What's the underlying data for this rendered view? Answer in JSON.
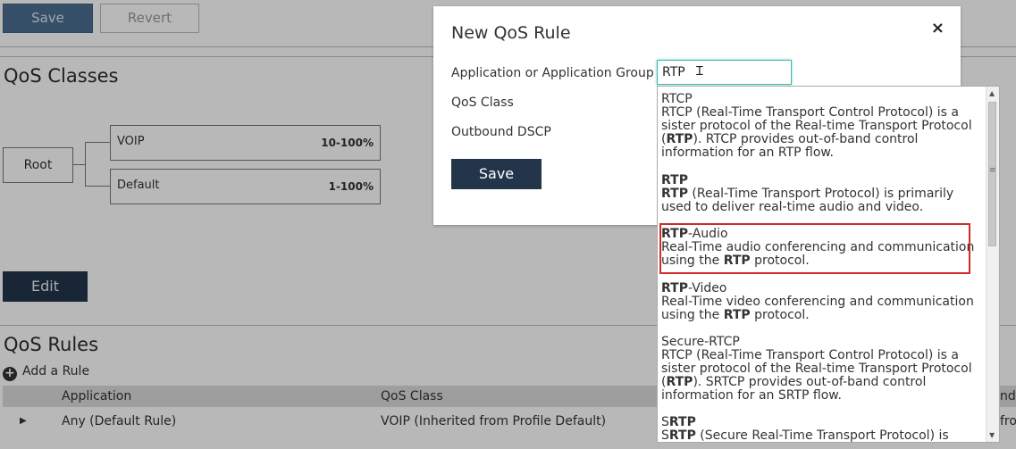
{
  "toolbar": {
    "save_label": "Save",
    "revert_label": "Revert"
  },
  "qos_classes": {
    "title": "QoS Classes",
    "root_label": "Root",
    "classes": [
      {
        "name": "VOIP",
        "range": "10-100%"
      },
      {
        "name": "Default",
        "range": "1-100%"
      }
    ],
    "edit_label": "Edit"
  },
  "qos_rules": {
    "title": "QoS Rules",
    "add_rule_label": "Add a Rule",
    "columns": [
      "Application",
      "QoS Class",
      "nd"
    ],
    "rows": [
      {
        "expand_icon": "▶",
        "application": "Any (Default Rule)",
        "qos_class": "VOIP (Inherited from Profile Default)",
        "extra": "fro"
      }
    ]
  },
  "modal": {
    "title": "New QoS Rule",
    "close_icon": "×",
    "fields": {
      "application_label": "Application or Application Group",
      "qos_class_label": "QoS Class",
      "dscp_label": "Outbound DSCP"
    },
    "application_value": "RTP",
    "save_label": "Save"
  },
  "autocomplete": {
    "options": [
      {
        "pre": "",
        "match": "",
        "post": "RTCP",
        "desc": [
          [
            "RTCP (Real-Time Transport Control Protocol) is a sister protocol of the Real-time Transport Protocol (",
            ""
          ],
          [
            "RTP",
            "b"
          ],
          [
            "). RTCP provides out-of-band control information for an RTP flow.",
            ""
          ]
        ]
      },
      {
        "pre": "",
        "match": "RTP",
        "post": "",
        "desc": [
          [
            "RTP",
            "b"
          ],
          [
            " (Real-Time Transport Protocol) is primarily used to deliver real-time audio and video.",
            ""
          ]
        ]
      },
      {
        "pre": "",
        "match": "RTP",
        "post": "-Audio",
        "desc": [
          [
            "Real-Time audio conferencing and communication using the ",
            ""
          ],
          [
            "RTP",
            "b"
          ],
          [
            " protocol.",
            ""
          ]
        ]
      },
      {
        "pre": "",
        "match": "RTP",
        "post": "-Video",
        "desc": [
          [
            "Real-Time video conferencing and communication using the ",
            ""
          ],
          [
            "RTP",
            "b"
          ],
          [
            " protocol.",
            ""
          ]
        ]
      },
      {
        "pre": "",
        "match": "",
        "post": "Secure-RTCP",
        "desc": [
          [
            "RTCP (Real-Time Transport Control Protocol) is a sister protocol of the Real-time Transport Protocol (",
            ""
          ],
          [
            "RTP",
            "b"
          ],
          [
            "). SRTCP provides out-of-band control information for an SRTP flow.",
            ""
          ]
        ]
      },
      {
        "pre": "S",
        "match": "RTP",
        "post": "",
        "desc": [
          [
            "S",
            ""
          ],
          [
            "RTP",
            "b"
          ],
          [
            " (Secure Real-Time Transport Protocol) is",
            ""
          ]
        ]
      }
    ],
    "highlighted_index": 2
  }
}
